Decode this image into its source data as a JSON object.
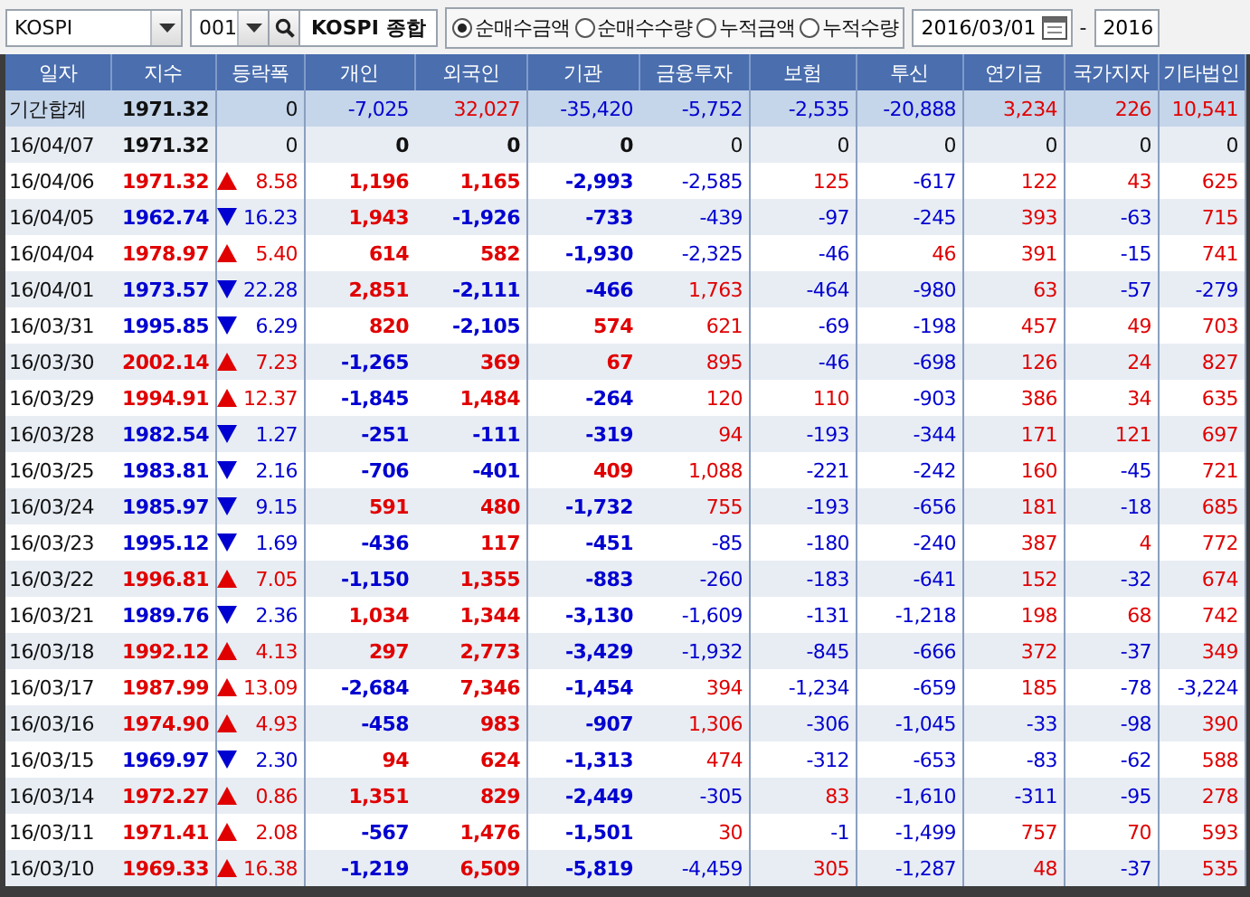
{
  "toolbar": {
    "market": "KOSPI",
    "code": "001",
    "index_name": "KOSPI 종합",
    "modes": [
      {
        "label": "순매수금액",
        "selected": true
      },
      {
        "label": "순매수수량",
        "selected": false
      },
      {
        "label": "누적금액",
        "selected": false
      },
      {
        "label": "누적수량",
        "selected": false
      }
    ],
    "date_from": "2016/03/01",
    "date_separator": "-",
    "date_to": "2016"
  },
  "table": {
    "columns": [
      "일자",
      "지수",
      "등락폭",
      "개인",
      "외국인",
      "기관",
      "금융투자",
      "보험",
      "투신",
      "연기금",
      "국가지자",
      "기타법인"
    ],
    "rows": [
      {
        "kind": "total",
        "date": "기간합계",
        "index": "1971.32",
        "change": {
          "kind": "none",
          "text": "0"
        },
        "values": [
          "-7,025",
          "32,027",
          "-35,420",
          "-5,752",
          "-2,535",
          "-20,888",
          "3,234",
          "226",
          "10,541"
        ]
      },
      {
        "kind": "day",
        "date": "16/04/07",
        "index": "1971.32",
        "change": {
          "kind": "none",
          "text": "0"
        },
        "values": [
          "0",
          "0",
          "0",
          "0",
          "0",
          "0",
          "0",
          "0",
          "0"
        ]
      },
      {
        "kind": "day",
        "date": "16/04/06",
        "index": "1971.32",
        "change": {
          "kind": "up",
          "text": "8.58"
        },
        "values": [
          "1,196",
          "1,165",
          "-2,993",
          "-2,585",
          "125",
          "-617",
          "122",
          "43",
          "625"
        ]
      },
      {
        "kind": "day",
        "date": "16/04/05",
        "index": "1962.74",
        "change": {
          "kind": "down",
          "text": "16.23"
        },
        "values": [
          "1,943",
          "-1,926",
          "-733",
          "-439",
          "-97",
          "-245",
          "393",
          "-63",
          "715"
        ]
      },
      {
        "kind": "day",
        "date": "16/04/04",
        "index": "1978.97",
        "change": {
          "kind": "up",
          "text": "5.40"
        },
        "values": [
          "614",
          "582",
          "-1,930",
          "-2,325",
          "-46",
          "46",
          "391",
          "-15",
          "741"
        ]
      },
      {
        "kind": "day",
        "date": "16/04/01",
        "index": "1973.57",
        "change": {
          "kind": "down",
          "text": "22.28"
        },
        "values": [
          "2,851",
          "-2,111",
          "-466",
          "1,763",
          "-464",
          "-980",
          "63",
          "-57",
          "-279"
        ]
      },
      {
        "kind": "day",
        "date": "16/03/31",
        "index": "1995.85",
        "change": {
          "kind": "down",
          "text": "6.29"
        },
        "values": [
          "820",
          "-2,105",
          "574",
          "621",
          "-69",
          "-198",
          "457",
          "49",
          "703"
        ]
      },
      {
        "kind": "day",
        "date": "16/03/30",
        "index": "2002.14",
        "change": {
          "kind": "up",
          "text": "7.23"
        },
        "values": [
          "-1,265",
          "369",
          "67",
          "895",
          "-46",
          "-698",
          "126",
          "24",
          "827"
        ]
      },
      {
        "kind": "day",
        "date": "16/03/29",
        "index": "1994.91",
        "change": {
          "kind": "up",
          "text": "12.37"
        },
        "values": [
          "-1,845",
          "1,484",
          "-264",
          "120",
          "110",
          "-903",
          "386",
          "34",
          "635"
        ]
      },
      {
        "kind": "day",
        "date": "16/03/28",
        "index": "1982.54",
        "change": {
          "kind": "down",
          "text": "1.27"
        },
        "values": [
          "-251",
          "-111",
          "-319",
          "94",
          "-193",
          "-344",
          "171",
          "121",
          "697"
        ]
      },
      {
        "kind": "day",
        "date": "16/03/25",
        "index": "1983.81",
        "change": {
          "kind": "down",
          "text": "2.16"
        },
        "values": [
          "-706",
          "-401",
          "409",
          "1,088",
          "-221",
          "-242",
          "160",
          "-45",
          "721"
        ]
      },
      {
        "kind": "day",
        "date": "16/03/24",
        "index": "1985.97",
        "change": {
          "kind": "down",
          "text": "9.15"
        },
        "values": [
          "591",
          "480",
          "-1,732",
          "755",
          "-193",
          "-656",
          "181",
          "-18",
          "685"
        ]
      },
      {
        "kind": "day",
        "date": "16/03/23",
        "index": "1995.12",
        "change": {
          "kind": "down",
          "text": "1.69"
        },
        "values": [
          "-436",
          "117",
          "-451",
          "-85",
          "-180",
          "-240",
          "387",
          "4",
          "772"
        ]
      },
      {
        "kind": "day",
        "date": "16/03/22",
        "index": "1996.81",
        "change": {
          "kind": "up",
          "text": "7.05"
        },
        "values": [
          "-1,150",
          "1,355",
          "-883",
          "-260",
          "-183",
          "-641",
          "152",
          "-32",
          "674"
        ]
      },
      {
        "kind": "day",
        "date": "16/03/21",
        "index": "1989.76",
        "change": {
          "kind": "down",
          "text": "2.36"
        },
        "values": [
          "1,034",
          "1,344",
          "-3,130",
          "-1,609",
          "-131",
          "-1,218",
          "198",
          "68",
          "742"
        ]
      },
      {
        "kind": "day",
        "date": "16/03/18",
        "index": "1992.12",
        "change": {
          "kind": "up",
          "text": "4.13"
        },
        "values": [
          "297",
          "2,773",
          "-3,429",
          "-1,932",
          "-845",
          "-666",
          "372",
          "-37",
          "349"
        ]
      },
      {
        "kind": "day",
        "date": "16/03/17",
        "index": "1987.99",
        "change": {
          "kind": "up",
          "text": "13.09"
        },
        "values": [
          "-2,684",
          "7,346",
          "-1,454",
          "394",
          "-1,234",
          "-659",
          "185",
          "-78",
          "-3,224"
        ]
      },
      {
        "kind": "day",
        "date": "16/03/16",
        "index": "1974.90",
        "change": {
          "kind": "up",
          "text": "4.93"
        },
        "values": [
          "-458",
          "983",
          "-907",
          "1,306",
          "-306",
          "-1,045",
          "-33",
          "-98",
          "390"
        ]
      },
      {
        "kind": "day",
        "date": "16/03/15",
        "index": "1969.97",
        "change": {
          "kind": "down",
          "text": "2.30"
        },
        "values": [
          "94",
          "624",
          "-1,313",
          "474",
          "-312",
          "-653",
          "-83",
          "-62",
          "588"
        ]
      },
      {
        "kind": "day",
        "date": "16/03/14",
        "index": "1972.27",
        "change": {
          "kind": "up",
          "text": "0.86"
        },
        "values": [
          "1,351",
          "829",
          "-2,449",
          "-305",
          "83",
          "-1,610",
          "-311",
          "-95",
          "278"
        ]
      },
      {
        "kind": "day",
        "date": "16/03/11",
        "index": "1971.41",
        "change": {
          "kind": "up",
          "text": "2.08"
        },
        "values": [
          "-567",
          "1,476",
          "-1,501",
          "30",
          "-1",
          "-1,499",
          "757",
          "70",
          "593"
        ]
      },
      {
        "kind": "day",
        "date": "16/03/10",
        "index": "1969.33",
        "change": {
          "kind": "up",
          "text": "16.38"
        },
        "values": [
          "-1,219",
          "6,509",
          "-5,819",
          "-4,459",
          "305",
          "-1,287",
          "48",
          "-37",
          "535"
        ]
      }
    ]
  }
}
